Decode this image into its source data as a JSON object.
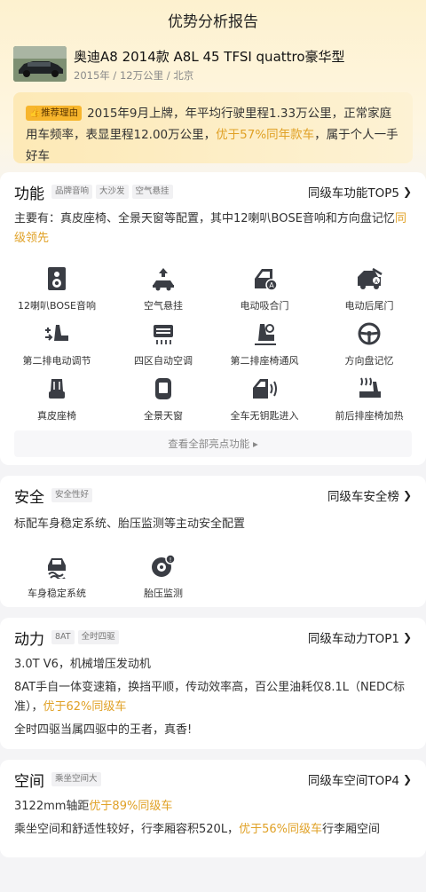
{
  "header": {
    "title": "优势分析报告"
  },
  "car": {
    "title": "奥迪A8 2014款 A8L 45 TFSI quattro豪华型",
    "meta": "2015年 / 12万公里 / 北京"
  },
  "recommend": {
    "badge": "推荐理由",
    "text1": "2015年9月上牌，年平均行驶里程1.33万公里，正常家庭用车频率，表显里程12.00万公里，",
    "highlight": "优于57%同年款车",
    "text2": "，属于个人一手好车"
  },
  "function": {
    "title": "功能",
    "tags": [
      "品牌音响",
      "大沙发",
      "空气悬挂"
    ],
    "link": "同级车功能TOP5",
    "desc": "主要有：真皮座椅、全景天窗等配置，其中12喇叭BOSE音响和方向盘记忆",
    "desc_highlight": "同级领先",
    "features": [
      {
        "label": "12喇叭BOSE音响",
        "icon": "speaker-icon"
      },
      {
        "label": "空气悬挂",
        "icon": "air-suspension-icon"
      },
      {
        "label": "电动吸合门",
        "icon": "soft-close-door-icon"
      },
      {
        "label": "电动后尾门",
        "icon": "power-tailgate-icon"
      },
      {
        "label": "第二排电动调节",
        "icon": "seat-adjust-icon"
      },
      {
        "label": "四区自动空调",
        "icon": "climate-icon"
      },
      {
        "label": "第二排座椅通风",
        "icon": "seat-ventilation-icon"
      },
      {
        "label": "方向盘记忆",
        "icon": "steering-wheel-icon"
      },
      {
        "label": "真皮座椅",
        "icon": "leather-seat-icon"
      },
      {
        "label": "全景天窗",
        "icon": "sunroof-icon"
      },
      {
        "label": "全车无钥匙进入",
        "icon": "keyless-entry-icon"
      },
      {
        "label": "前后排座椅加热",
        "icon": "seat-heating-icon"
      }
    ],
    "view_all": "查看全部亮点功能"
  },
  "safety": {
    "title": "安全",
    "tags": [
      "安全性好"
    ],
    "link": "同级车安全榜",
    "desc": "标配车身稳定系统、胎压监测等主动安全配置",
    "features": [
      {
        "label": "车身稳定系统",
        "icon": "stability-icon"
      },
      {
        "label": "胎压监测",
        "icon": "tire-pressure-icon"
      }
    ]
  },
  "power": {
    "title": "动力",
    "tags": [
      "8AT",
      "全时四驱"
    ],
    "link": "同级车动力TOP1",
    "line1": "3.0T V6，机械增压发动机",
    "line2": "8AT手自一体变速箱，换挡平顺，传动效率高，百公里油耗仅8.1L（NEDC标准），",
    "line2_highlight": "优于62%同级车",
    "line3": "全时四驱当属四驱中的王者，真香!"
  },
  "space": {
    "title": "空间",
    "tags": [
      "乘坐空间大"
    ],
    "link": "同级车空间TOP4",
    "line1": "3122mm轴距",
    "line1_highlight": "优于89%同级车",
    "line2": "乘坐空间和舒适性较好，行李厢容积520L，",
    "line2_highlight": "优于56%同级车",
    "line2_tail": "行李厢空间"
  },
  "colors": {
    "accent": "#e0a126",
    "badge": "#f7b52c"
  }
}
